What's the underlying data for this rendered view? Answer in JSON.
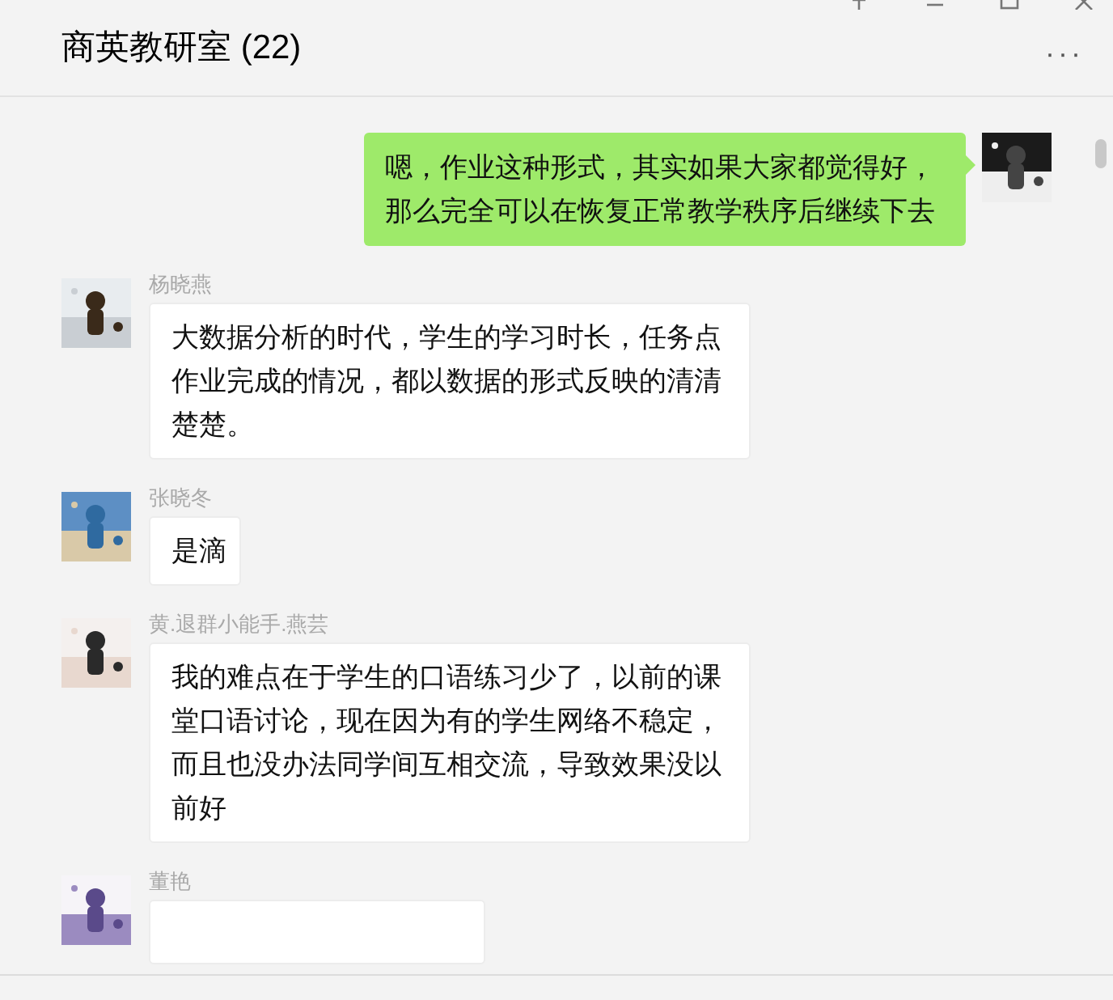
{
  "window": {
    "title": "商英教研室 (22)",
    "more": "···"
  },
  "messages": [
    {
      "kind": "outgoing",
      "text": "嗯，作业这种形式，其实如果大家都觉得好，那么完全可以在恢复正常教学秩序后继续下去"
    },
    {
      "kind": "incoming",
      "sender": "杨晓燕",
      "text": "大数据分析的时代，学生的学习时长，任务点作业完成的情况，都以数据的形式反映的清清楚楚。"
    },
    {
      "kind": "incoming",
      "sender": "张晓冬",
      "text": "是滴"
    },
    {
      "kind": "incoming",
      "sender": "黄.退群小能手.燕芸",
      "text": "我的难点在于学生的口语练习少了，以前的课堂口语讨论，现在因为有的学生网络不稳定，而且也没办法同学间互相交流，导致效果没以前好"
    },
    {
      "kind": "incoming",
      "sender": "董艳"
    }
  ]
}
